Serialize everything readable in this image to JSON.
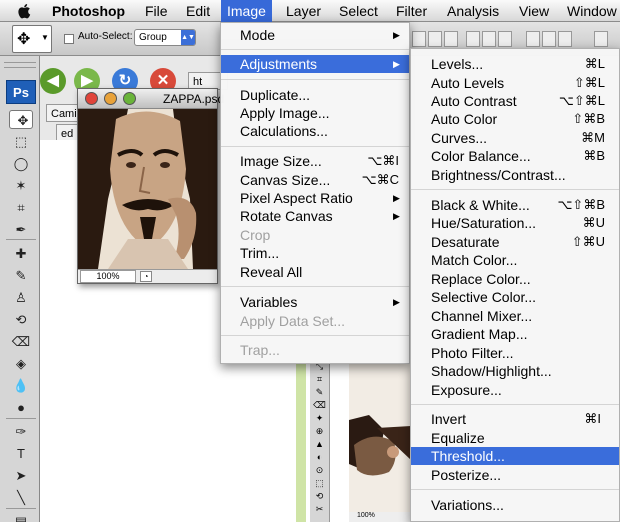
{
  "menubar": {
    "app": "Photoshop",
    "items": [
      "File",
      "Edit",
      "Image",
      "Layer",
      "Select",
      "Filter",
      "Analysis",
      "View",
      "Window"
    ],
    "active": "Image"
  },
  "options_bar": {
    "auto_select_label": "Auto-Select:",
    "auto_select_value": "Group"
  },
  "tools_panel": {
    "logo": "Ps"
  },
  "browser": {
    "tab1": "Camin",
    "tab2": "ed",
    "tab3": "ht"
  },
  "document": {
    "title": "ZAPPA.psd",
    "zoom": "100%"
  },
  "bg_document": {
    "zoom": "100%"
  },
  "image_menu": [
    {
      "label": "Mode",
      "submenu": true
    },
    {
      "label": "Adjustments",
      "submenu": true,
      "highlighted": true
    },
    {
      "label": "Duplicate..."
    },
    {
      "label": "Apply Image..."
    },
    {
      "label": "Calculations..."
    },
    {
      "label": "Image Size...",
      "shortcut": "⌥⌘I"
    },
    {
      "label": "Canvas Size...",
      "shortcut": "⌥⌘C"
    },
    {
      "label": "Pixel Aspect Ratio",
      "submenu": true
    },
    {
      "label": "Rotate Canvas",
      "submenu": true
    },
    {
      "label": "Crop",
      "disabled": true
    },
    {
      "label": "Trim..."
    },
    {
      "label": "Reveal All"
    },
    {
      "label": "Variables",
      "submenu": true
    },
    {
      "label": "Apply Data Set...",
      "disabled": true
    },
    {
      "label": "Trap...",
      "disabled": true
    }
  ],
  "adjustments_menu": [
    {
      "label": "Levels...",
      "shortcut": "⌘L"
    },
    {
      "label": "Auto Levels",
      "shortcut": "⇧⌘L"
    },
    {
      "label": "Auto Contrast",
      "shortcut": "⌥⇧⌘L"
    },
    {
      "label": "Auto Color",
      "shortcut": "⇧⌘B"
    },
    {
      "label": "Curves...",
      "shortcut": "⌘M"
    },
    {
      "label": "Color Balance...",
      "shortcut": "⌘B"
    },
    {
      "label": "Brightness/Contrast..."
    },
    {
      "label": "Black & White...",
      "shortcut": "⌥⇧⌘B"
    },
    {
      "label": "Hue/Saturation...",
      "shortcut": "⌘U"
    },
    {
      "label": "Desaturate",
      "shortcut": "⇧⌘U"
    },
    {
      "label": "Match Color..."
    },
    {
      "label": "Replace Color..."
    },
    {
      "label": "Selective Color..."
    },
    {
      "label": "Channel Mixer..."
    },
    {
      "label": "Gradient Map..."
    },
    {
      "label": "Photo Filter..."
    },
    {
      "label": "Shadow/Highlight..."
    },
    {
      "label": "Exposure..."
    },
    {
      "label": "Invert",
      "shortcut": "⌘I"
    },
    {
      "label": "Equalize"
    },
    {
      "label": "Threshold...",
      "highlighted": true
    },
    {
      "label": "Posterize..."
    },
    {
      "label": "Variations..."
    }
  ],
  "colors": {
    "highlight": "#3a6ddb",
    "ps_logo": "#1f5fb8"
  }
}
